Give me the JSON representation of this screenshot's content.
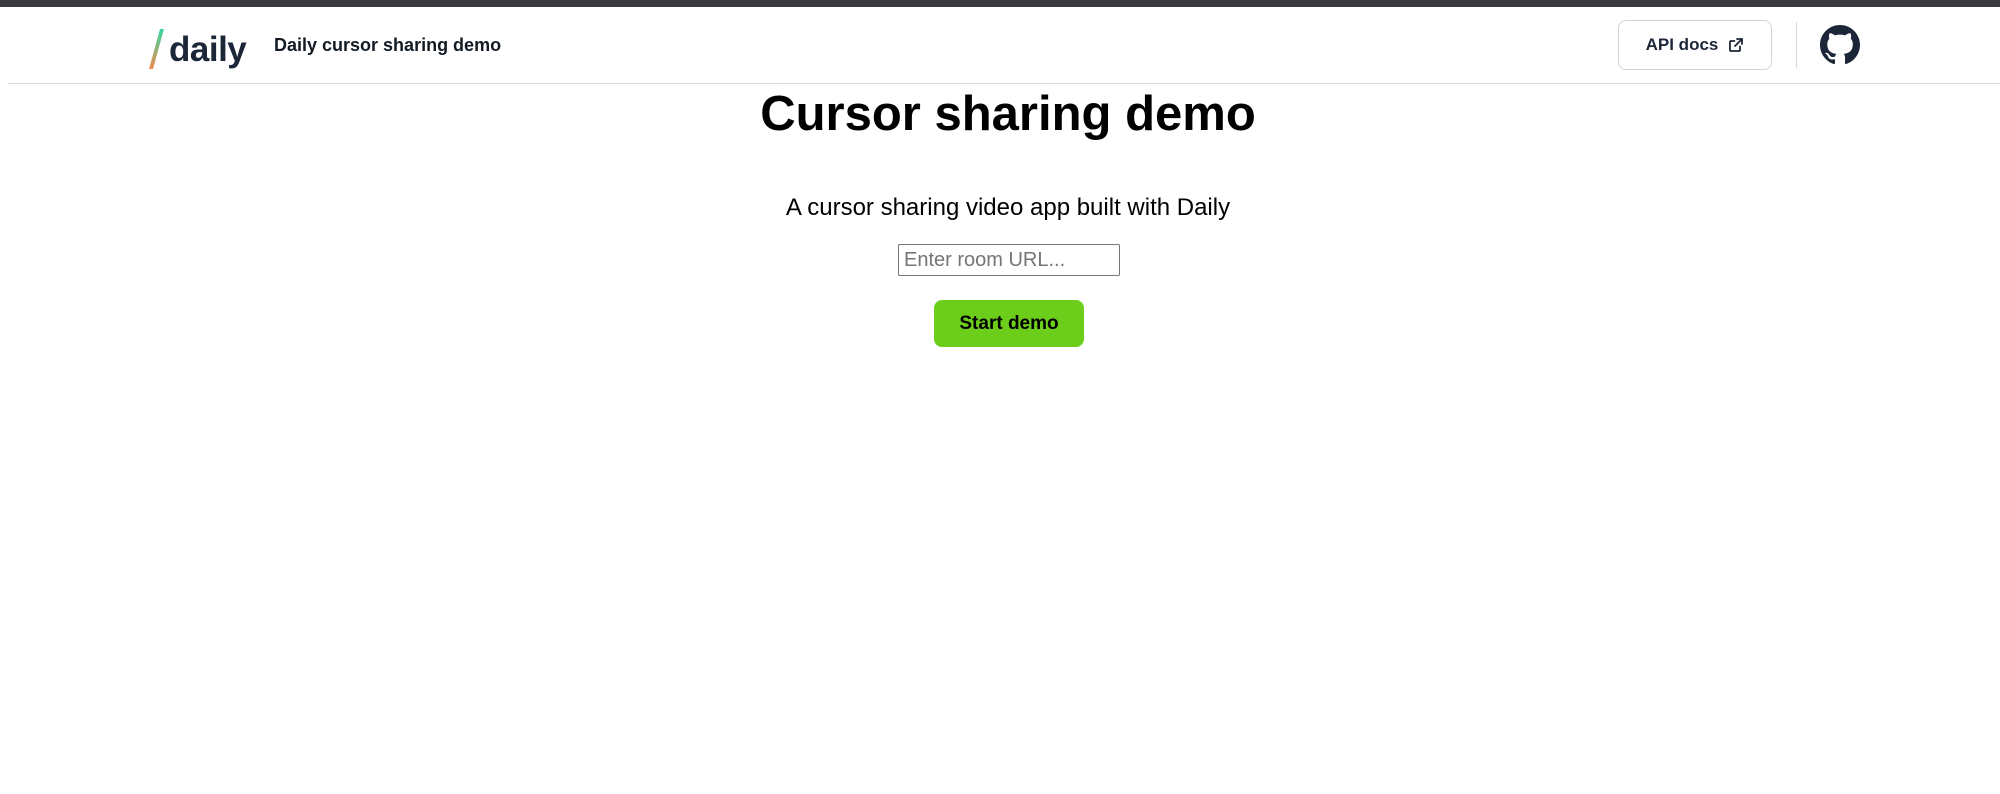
{
  "header": {
    "logo_text": "daily",
    "app_title": "Daily cursor sharing demo",
    "api_docs_label": "API docs",
    "github_icon": "github-icon",
    "external_link_icon": "external-link-icon"
  },
  "main": {
    "title": "Cursor sharing demo",
    "subtitle": "A cursor sharing video app built with Daily",
    "room_input": {
      "value": "",
      "placeholder": "Enter room URL..."
    },
    "start_button_label": "Start demo"
  },
  "colors": {
    "start_button": "#6ccd1a",
    "logo_text": "#1b2638",
    "logo_slash_top": "#38d6a3",
    "logo_slash_bottom": "#f28b4a",
    "top_strip": "#3a3b3f"
  }
}
